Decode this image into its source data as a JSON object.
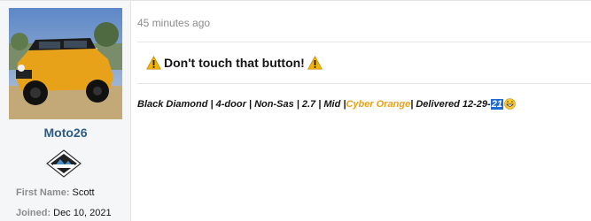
{
  "user": {
    "username": "Moto26",
    "avatar": "orange-suv-photo",
    "badge": "black-diamond-badge",
    "first_name_label": "First Name:",
    "first_name_value": "Scott",
    "joined_label": "Joined:",
    "joined_value": "Dec 10, 2021"
  },
  "post": {
    "timestamp": "45 minutes ago",
    "message": "Don't touch that button!",
    "signature": {
      "part1": "Black Diamond | 4-door | Non-Sas | 2.7 | Mid | ",
      "color_text": "Cyber Orange",
      "part2": " | Delivered 12-29-",
      "highlight": "21",
      "color": "#e8a21a"
    }
  },
  "icons": {
    "warning": "warning-icon",
    "grin": "grinning-face-icon"
  }
}
